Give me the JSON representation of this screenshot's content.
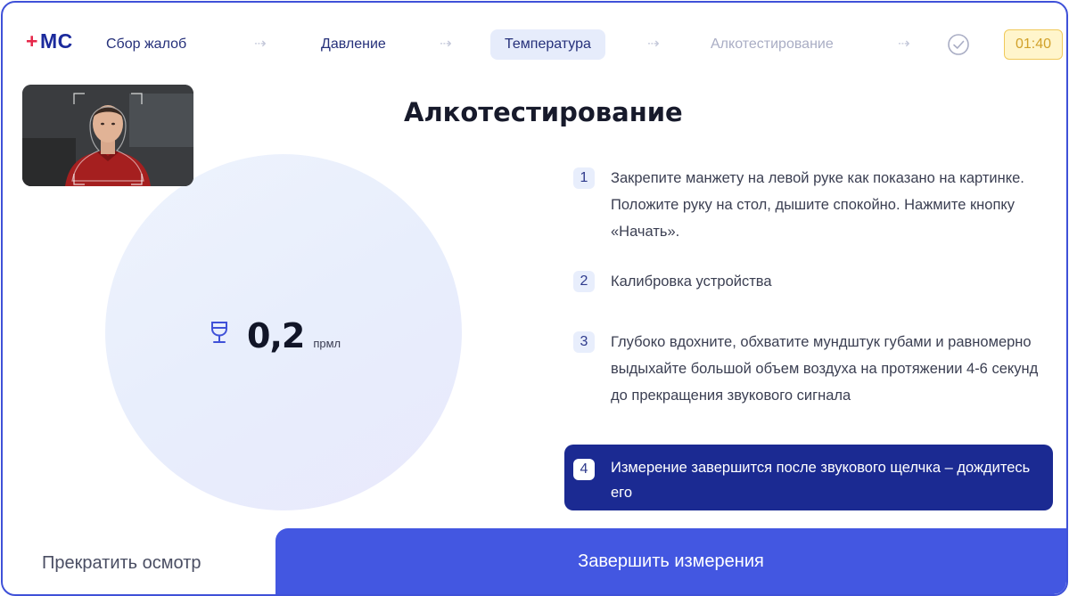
{
  "header": {
    "logo_plus": "+",
    "logo_text": "МС",
    "steps": [
      {
        "label": "Сбор жалоб",
        "state": "done"
      },
      {
        "label": "Давление",
        "state": "done"
      },
      {
        "label": "Температура",
        "state": "active"
      },
      {
        "label": "Алкотестирование",
        "state": "pending"
      }
    ],
    "arrow": "⇢",
    "finish_icon": "check-circle-icon",
    "timer": "01:40"
  },
  "camera": {
    "icon": "face-frame-icon"
  },
  "measurement": {
    "icon": "wine-glass-icon",
    "value": "0,2",
    "unit": "прмл"
  },
  "title": "Алкотестирование",
  "instructions": [
    {
      "number": "1",
      "text": "Закрепите манжету на левой руке как показано на картинке. Положите руку на стол, дышите спокойно. Нажмите кнопку «Начать».",
      "active": false
    },
    {
      "number": "2",
      "text": "Калибровка устройства",
      "active": false
    },
    {
      "number": "3",
      "text": "Глубоко вдохните, обхватите мундштук губами и равномерно выдыхайте большой объем воздуха на протяжении 4-6 секунд до прекращения звукового сигнала",
      "active": false
    },
    {
      "number": "4",
      "text": "Измерение завершится после звукового щелчка – дождитесь его",
      "active": true
    }
  ],
  "footer": {
    "stop_label": "Прекратить осмотр",
    "finish_label": "Завершить измерения"
  },
  "colors": {
    "primary": "#4357e1",
    "dark_accent": "#1b2a92",
    "logo": "#1b2a9c",
    "logo_plus": "#e6284a",
    "timer_bg": "#fff5cc",
    "timer_text": "#d1a12a"
  }
}
